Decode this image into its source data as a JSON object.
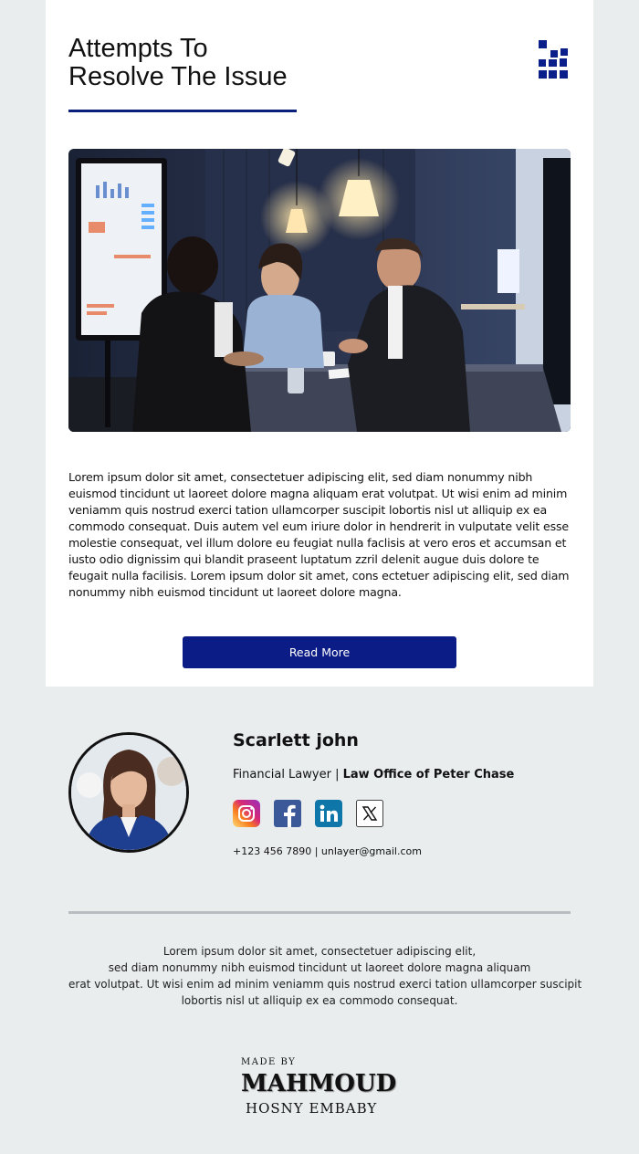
{
  "article": {
    "title_line1": "Attempts To",
    "title_line2": "Resolve The Issue",
    "body": "Lorem ipsum dolor sit amet, consectetuer adipiscing elit, sed diam nonummy nibh euismod tincidunt ut laoreet dolore magna aliquam erat volutpat. Ut wisi enim ad minim veniamm quis nostrud exerci tation ullamcorper suscipit lobortis nisl ut alliquip ex ea commodo consequat. Duis autem vel eum iriure dolor in hendrerit in vulputate velit esse molestie consequat, vel illum dolore eu feugiat nulla faclisis at vero eros et accumsan et iusto odio dignissim qui blandit praseent luptatum zzril delenit augue duis dolore te feugait nulla facilisis. Lorem ipsum dolor sit amet, cons ectetuer adipiscing elit, sed diam nonummy nibh euismod tincidunt ut laoreet dolore magna.",
    "read_more_label": "Read More"
  },
  "signature": {
    "name": "Scarlett john",
    "role": "Financial Lawyer",
    "separator": " | ",
    "company": "Law Office of Peter Chase",
    "contact": "+123 456 7890 | unlayer@gmail.com",
    "socials": [
      "instagram-icon",
      "facebook-icon",
      "linkedin-icon",
      "x-twitter-icon"
    ]
  },
  "footer": {
    "lines": [
      "Lorem ipsum dolor sit amet, consectetuer adipiscing elit,",
      "sed diam nonummy nibh euismod tincidunt ut laoreet dolore magna aliquam",
      "erat volutpat. Ut wisi enim ad minim veniamm quis nostrud exerci tation ullamcorper suscipit",
      "lobortis nisl ut alliquip ex ea commodo consequat."
    ],
    "made_by_small": "MADE BY",
    "made_by_name": "MAHMOUD",
    "made_by_sub": "HOSNY EMBABY"
  },
  "colors": {
    "accent": "#0b1c86",
    "page_bg": "#e9edee",
    "card_bg": "#ffffff"
  }
}
